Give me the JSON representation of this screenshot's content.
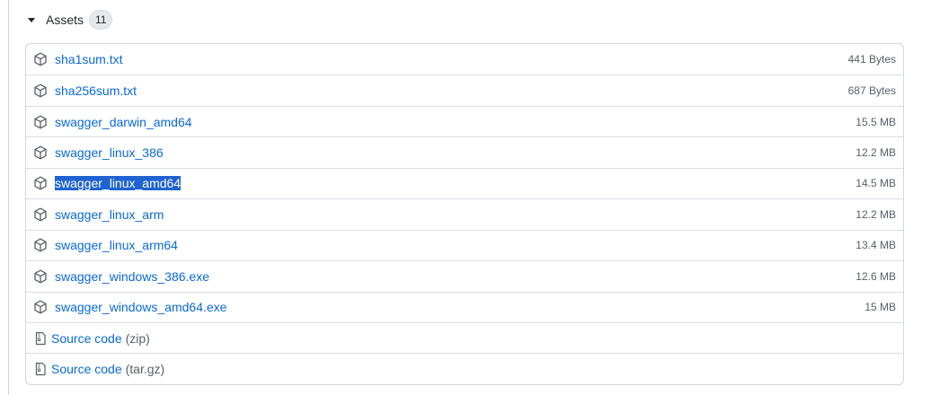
{
  "assets": {
    "title": "Assets",
    "count": "11",
    "items": [
      {
        "name": "sha1sum.txt",
        "size": "441 Bytes"
      },
      {
        "name": "sha256sum.txt",
        "size": "687 Bytes"
      },
      {
        "name": "swagger_darwin_amd64",
        "size": "15.5 MB"
      },
      {
        "name": "swagger_linux_386",
        "size": "12.2 MB"
      },
      {
        "name": "swagger_linux_amd64",
        "size": "14.5 MB"
      },
      {
        "name": "swagger_linux_arm",
        "size": "12.2 MB"
      },
      {
        "name": "swagger_linux_arm64",
        "size": "13.4 MB"
      },
      {
        "name": "swagger_windows_386.exe",
        "size": "12.6 MB"
      },
      {
        "name": "swagger_windows_amd64.exe",
        "size": "15 MB"
      }
    ],
    "source": [
      {
        "label": "Source code",
        "type": "(zip)"
      },
      {
        "label": "Source code",
        "type": "(tar.gz)"
      }
    ]
  },
  "colors": {
    "link": "#0969da",
    "selection": "#1e63d1",
    "muted": "#57606a",
    "border": "#d0d7de"
  },
  "icons": {
    "asset": "package-icon",
    "source": "file-zip-icon",
    "toggle": "triangle-down-icon"
  }
}
